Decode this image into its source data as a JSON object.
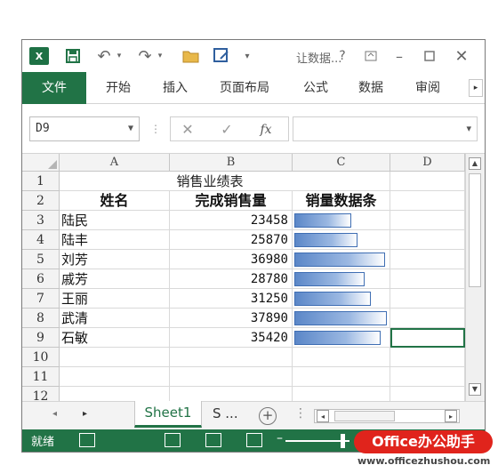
{
  "qat": {
    "doc_title": "让数据..."
  },
  "ribbon": {
    "tabs": [
      "文件",
      "开始",
      "插入",
      "页面布局",
      "公式",
      "数据",
      "审阅"
    ]
  },
  "formula_bar": {
    "name_box": "D9",
    "fx": "fx",
    "formula": ""
  },
  "sheet": {
    "columns": [
      "A",
      "B",
      "C",
      "D"
    ],
    "rows": [
      "1",
      "2",
      "3",
      "4",
      "5",
      "6",
      "7",
      "8",
      "9",
      "10",
      "11",
      "12"
    ],
    "title": "销售业绩表",
    "headers": [
      "姓名",
      "完成销售量",
      "销量数据条"
    ],
    "data": [
      {
        "name": "陆民",
        "value": 23458
      },
      {
        "name": "陆丰",
        "value": 25870
      },
      {
        "name": "刘芳",
        "value": 36980
      },
      {
        "name": "戚芳",
        "value": 28780
      },
      {
        "name": "王丽",
        "value": 31250
      },
      {
        "name": "武清",
        "value": 37890
      },
      {
        "name": "石敏",
        "value": 35420
      }
    ]
  },
  "sheet_tabs": {
    "active": "Sheet1",
    "more": "S ...",
    "add": "+"
  },
  "status": {
    "text": "就绪"
  },
  "watermark": {
    "badge": "Office办公助手",
    "url": "www.officezhushou.com"
  },
  "colors": {
    "accent": "#217346",
    "bar": "#5b87c8"
  }
}
